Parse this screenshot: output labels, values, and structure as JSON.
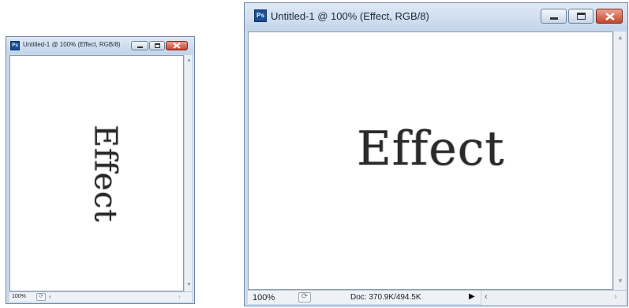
{
  "left_window": {
    "app_icon": "photoshop-icon",
    "icon_label": "Ps",
    "title": "Untitled-1 @ 100% (Effect, RGB/8)",
    "canvas_text": "Effect",
    "status": {
      "zoom": "100%",
      "status_icon": "history-icon"
    }
  },
  "right_window": {
    "app_icon": "photoshop-icon",
    "icon_label": "Ps",
    "title": "Untitled-1 @ 100% (Effect, RGB/8)",
    "canvas_text": "Effect",
    "status": {
      "zoom": "100%",
      "status_icon": "history-icon",
      "doc_info": "Doc: 370.9K/494.5K"
    }
  },
  "colors": {
    "title_bar": "#c3d5ea",
    "close_button": "#c5452c",
    "frame": "#6f86a6"
  }
}
